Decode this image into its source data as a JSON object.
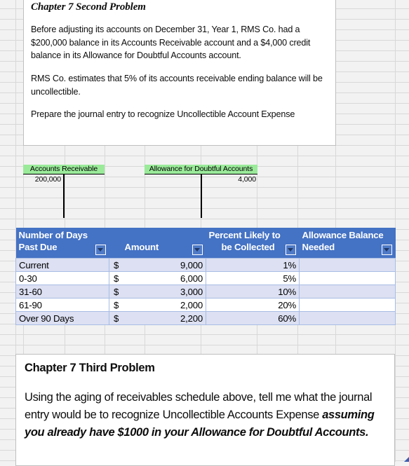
{
  "problem2": {
    "title": "Chapter 7 Second Problem",
    "paragraph1": "Before adjusting its accounts on December 31, Year 1, RMS Co. had a $200,000 balance in its Accounts Receivable account and a $4,000 credit balance in its Allowance for Doubtful Accounts account.",
    "paragraph2": "RMS Co.  estimates that 5% of its accounts receivable ending balance will be uncollectible.",
    "paragraph3": "Prepare the journal entry to recognize Uncollectible Account Expense"
  },
  "t_accounts": [
    {
      "name": "accounts-receivable",
      "title": "Accounts Receivable",
      "debit": "200,000",
      "credit": ""
    },
    {
      "name": "allowance-for-doubtful-accounts",
      "title": "Allowance for Doubtful Accounts",
      "debit": "",
      "credit": "4,000"
    }
  ],
  "aging_table": {
    "headers": [
      "Number of Days Past Due",
      "Amount",
      "Percent Likely to be Collected",
      "Allowance Balance Needed"
    ],
    "header_lines": [
      [
        "Number of Days",
        "Past Due"
      ],
      [
        "",
        "Amount"
      ],
      [
        "Percent Likely to",
        "be Collected"
      ],
      [
        "Allowance Balance",
        "Needed"
      ]
    ],
    "rows": [
      {
        "past_due": "Current",
        "currency": "$",
        "amount": "9,000",
        "percent": "1%",
        "needed": ""
      },
      {
        "past_due": "0-30",
        "currency": "$",
        "amount": "6,000",
        "percent": "5%",
        "needed": ""
      },
      {
        "past_due": "31-60",
        "currency": "$",
        "amount": "3,000",
        "percent": "10%",
        "needed": ""
      },
      {
        "past_due": "61-90",
        "currency": "$",
        "amount": "2,000",
        "percent": "20%",
        "needed": ""
      },
      {
        "past_due": "Over 90 Days",
        "currency": "$",
        "amount": "2,200",
        "percent": "60%",
        "needed": ""
      }
    ]
  },
  "problem3": {
    "title": "Chapter 7 Third Problem",
    "body_plain": "Using the aging of receivables schedule above, tell me what the journal entry would be to recognize Uncollectible Accounts Expense ",
    "body_emphasis": "assuming you already have $1000 in your Allowance for Doubtful Accounts."
  },
  "colors": {
    "table_header": "#4472c4",
    "row_band": "#dce0f2",
    "t_account_header": "#9aea9a",
    "grid_line": "#d8d8d8",
    "page_background": "#f2f2f2"
  }
}
